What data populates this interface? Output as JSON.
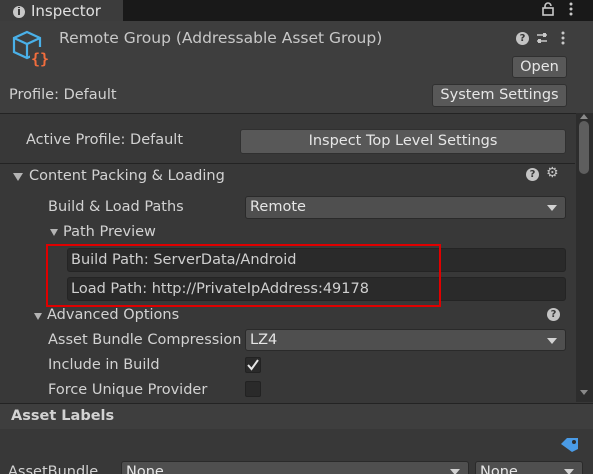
{
  "window": {
    "tab_title": "Inspector",
    "top_icons": "🔒 ⋮"
  },
  "header": {
    "title": "Remote Group (Addressable Asset Group)",
    "open_button": "Open",
    "profile_label": "Profile: Default",
    "system_settings_button": "System Settings"
  },
  "active_profile": {
    "label": "Active Profile: Default",
    "inspect_button": "Inspect Top Level Settings"
  },
  "content_packing": {
    "section_title": "Content Packing & Loading",
    "build_load_paths_label": "Build & Load Paths",
    "build_load_paths_value": "Remote",
    "path_preview_label": "Path Preview",
    "build_path": "Build Path: ServerData/Android",
    "load_path": "Load Path: http://PrivateIpAddress:49178"
  },
  "advanced": {
    "section_title": "Advanced Options",
    "compression_label": "Asset Bundle Compression",
    "compression_value": "LZ4",
    "include_in_build_label": "Include in Build",
    "include_in_build_checked": true,
    "force_unique_label": "Force Unique Provider",
    "force_unique_checked": false
  },
  "asset_labels": {
    "title": "Asset Labels",
    "asset_bundle_label": "AssetBundle",
    "bundle_value": "None",
    "variant_value": "None"
  },
  "colors": {
    "highlight": "#e00000",
    "panel_bg": "#383838"
  }
}
